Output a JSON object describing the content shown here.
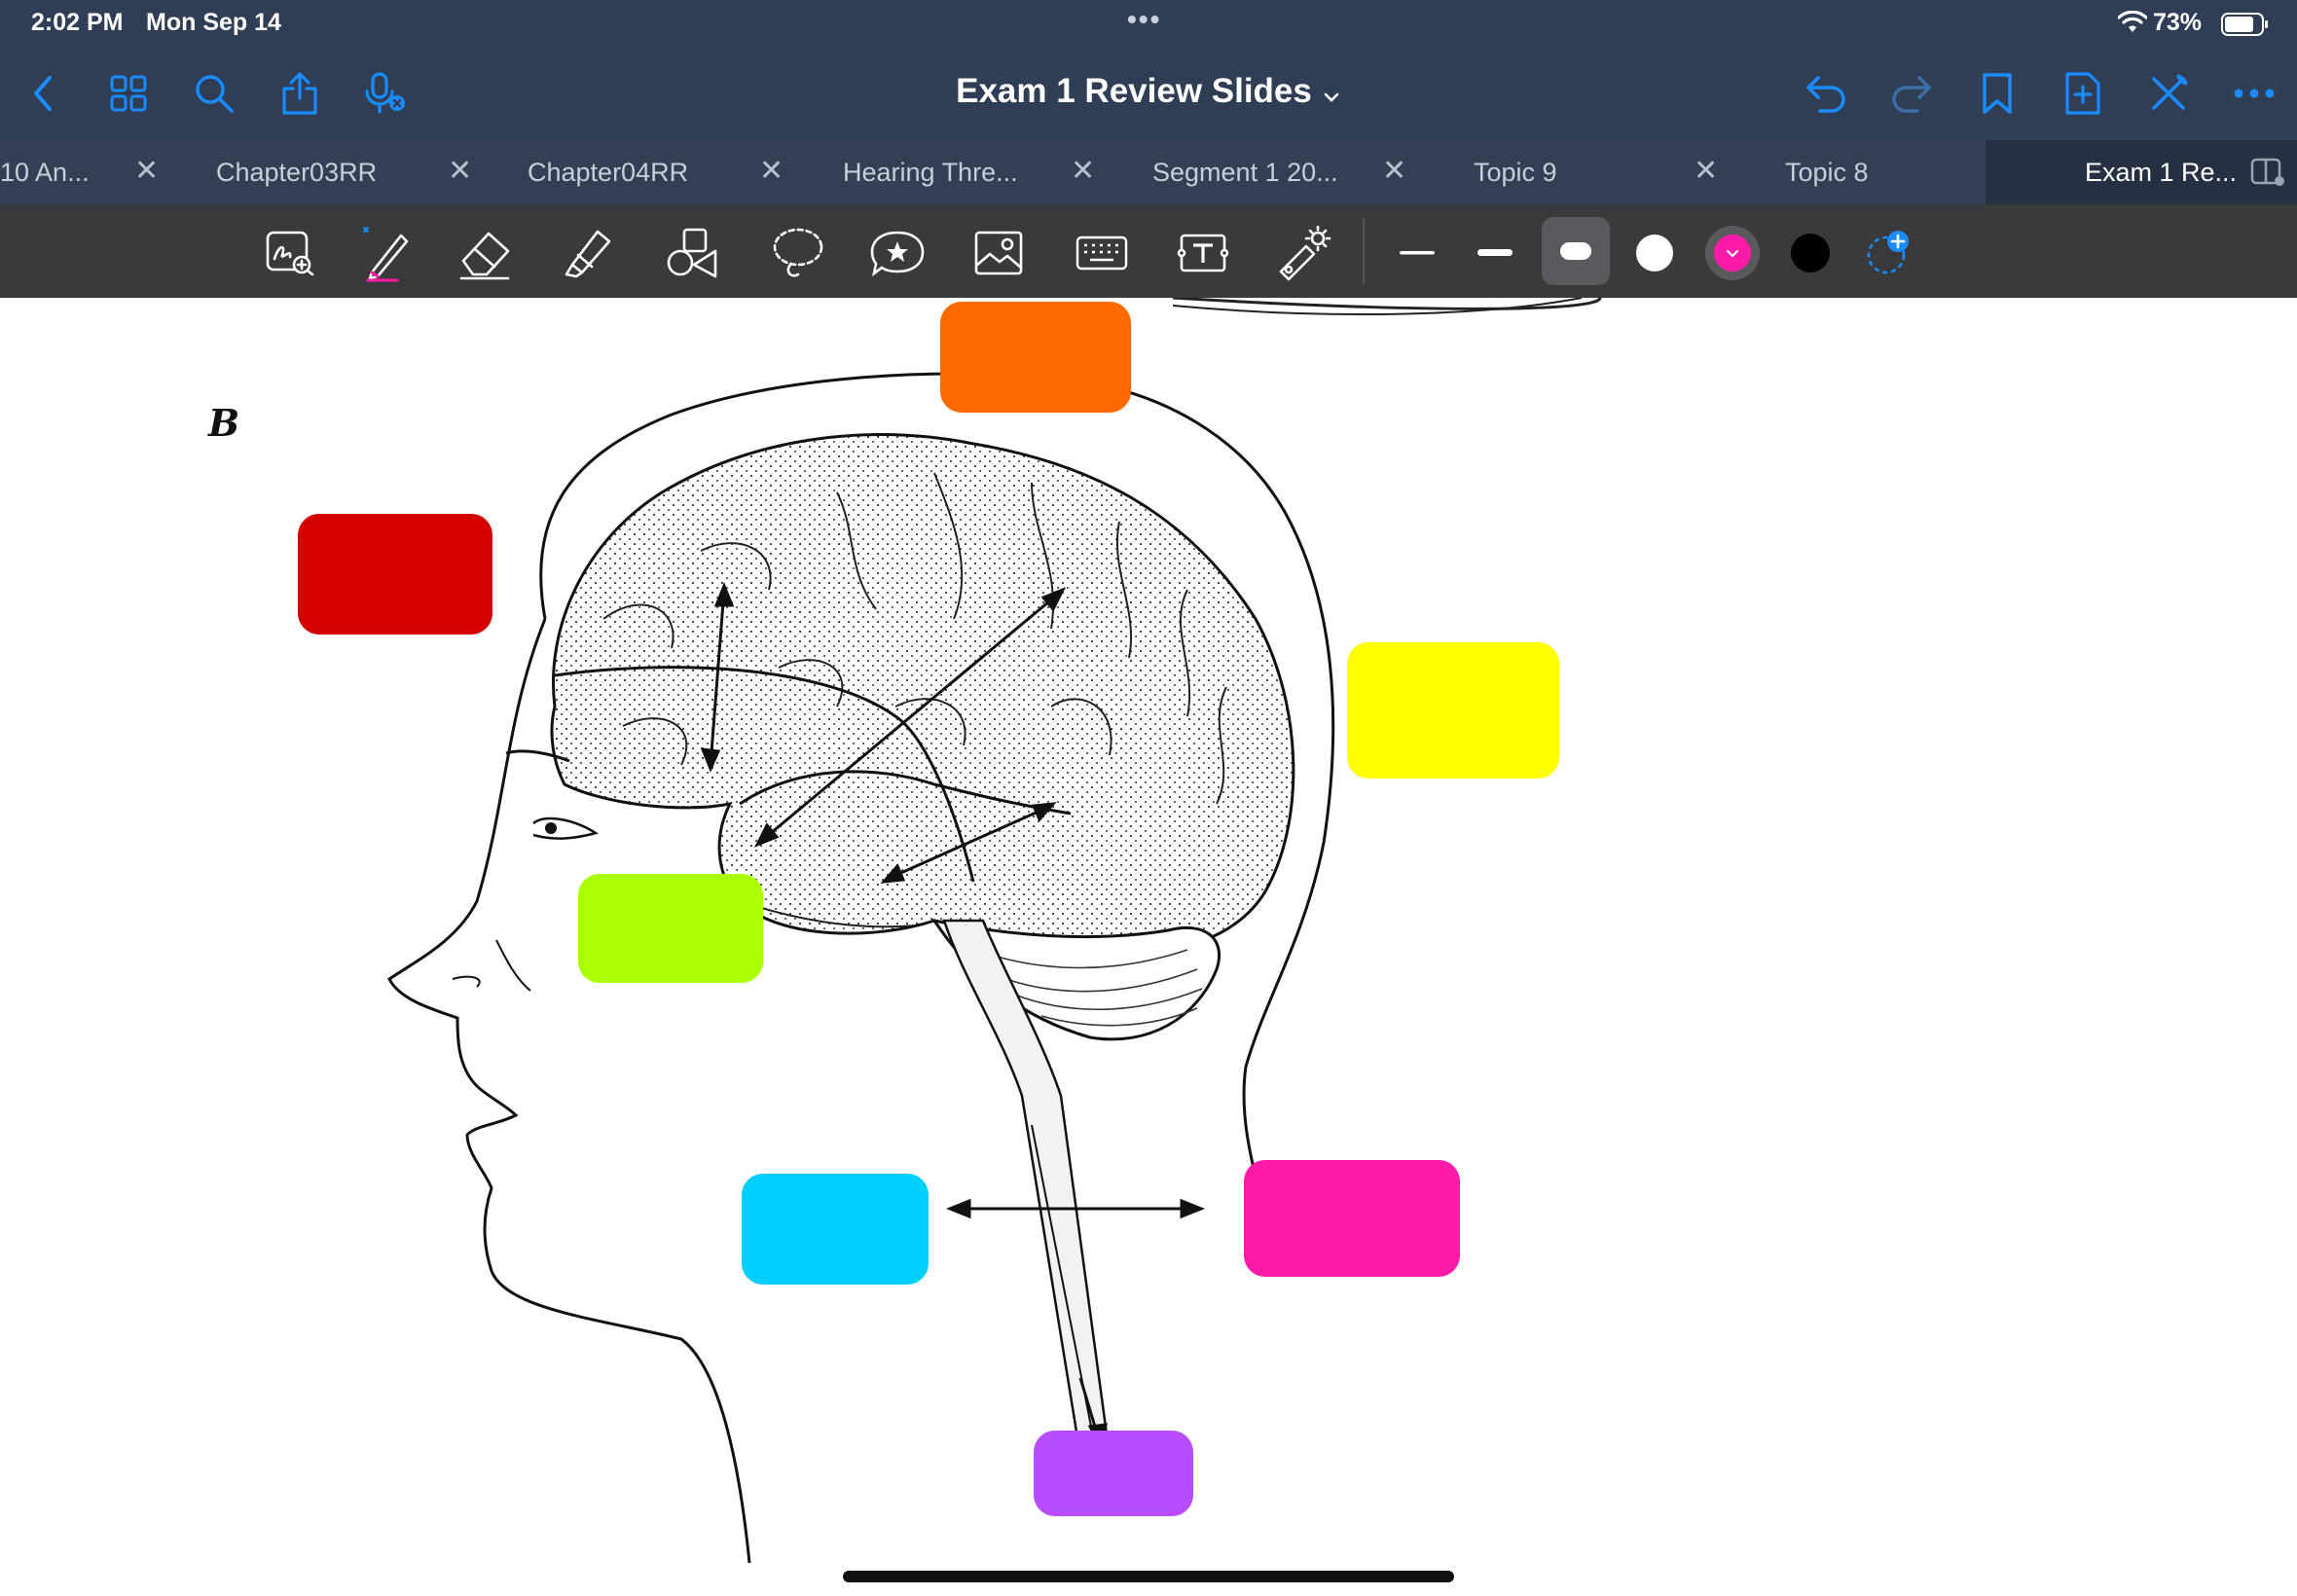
{
  "status": {
    "time": "2:02 PM",
    "date": "Mon Sep 14",
    "battery": "73%"
  },
  "nav": {
    "title": "Exam 1 Review Slides",
    "icons": [
      "back-icon",
      "thumbnails-icon",
      "search-icon",
      "share-icon",
      "mic-icon",
      "undo-icon",
      "redo-icon",
      "bookmark-icon",
      "add-page-icon",
      "close-pen-icon",
      "more-icon"
    ]
  },
  "tabs": [
    {
      "label": "10 An...",
      "active": false
    },
    {
      "label": "Chapter03RR",
      "active": false
    },
    {
      "label": "Chapter04RR",
      "active": false
    },
    {
      "label": "Hearing Thre...",
      "active": false
    },
    {
      "label": "Segment 1 20...",
      "active": false
    },
    {
      "label": "Topic 9",
      "active": false
    },
    {
      "label": "Topic 8",
      "active": false
    },
    {
      "label": "Exam 1 Re...",
      "active": true
    }
  ],
  "toolbar": {
    "tools": [
      "zoom-box-icon",
      "pen-icon",
      "eraser-icon",
      "highlighter-icon",
      "shapes-icon",
      "lasso-icon",
      "sticker-icon",
      "image-icon",
      "keyboard-icon",
      "text-box-icon",
      "laser-pointer-icon"
    ],
    "selected_tool": "pen-icon",
    "colors": [
      "#ffffff",
      "#ff1aa8",
      "#000000"
    ],
    "selected_color": "#ff1aa8"
  },
  "slide": {
    "figure_label": "B",
    "redaction_colors": {
      "orange": "#ff6a00",
      "red": "#d40000",
      "yellow": "#ffff00",
      "lime": "#aaff00",
      "cyan": "#00cfff",
      "pink": "#ff1aa8",
      "purple": "#b84dff"
    }
  }
}
